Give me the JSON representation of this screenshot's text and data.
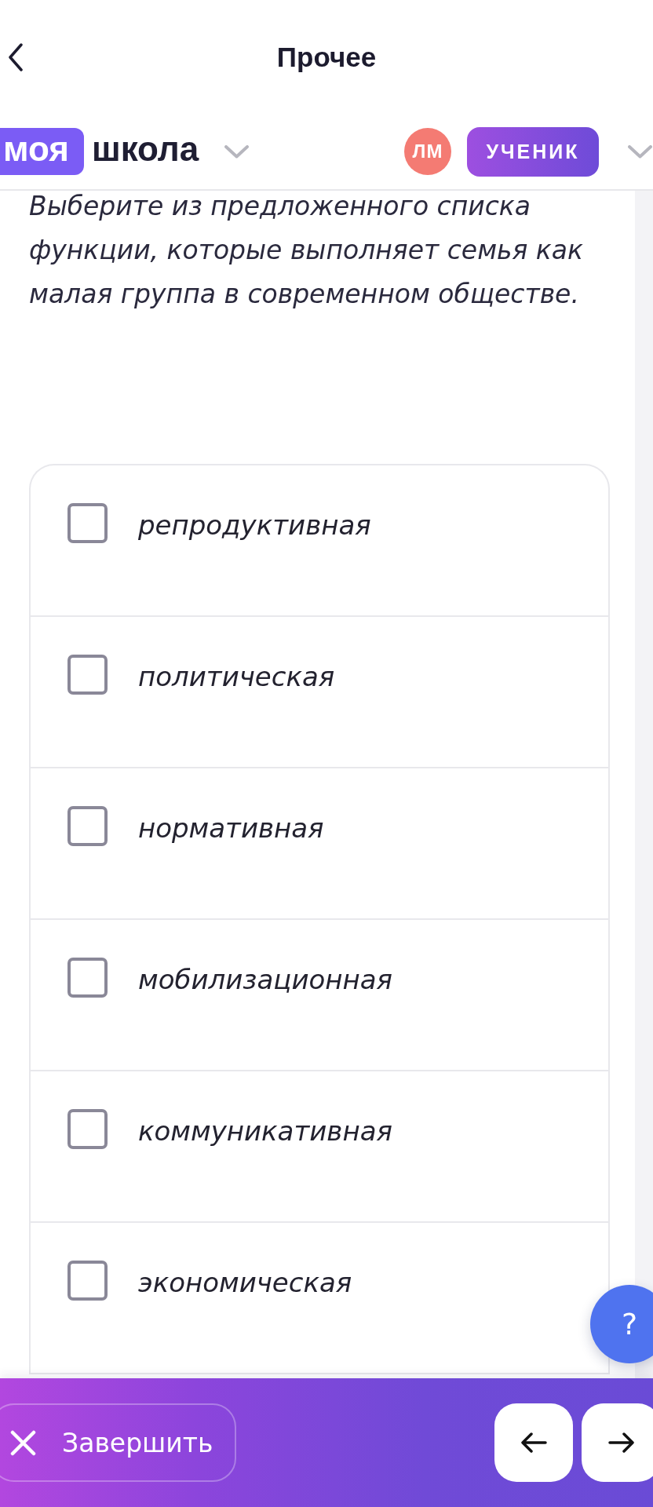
{
  "header": {
    "title": "Прочее"
  },
  "brand": {
    "badge": "моя",
    "name": "школа"
  },
  "user": {
    "initials": "ЛМ",
    "role": "УЧЕНИК"
  },
  "question": {
    "text": "Выберите из предложенного списка функции, которые выполняет семья как малая группа в современном обществе."
  },
  "options": [
    {
      "label": "репродуктивная",
      "checked": false
    },
    {
      "label": "политическая",
      "checked": false
    },
    {
      "label": "нормативная",
      "checked": false
    },
    {
      "label": "мобилизационная",
      "checked": false
    },
    {
      "label": "коммуникативная",
      "checked": false
    },
    {
      "label": "экономическая",
      "checked": false
    }
  ],
  "footer": {
    "finish": "Завершить"
  },
  "help": {
    "label": "?"
  }
}
